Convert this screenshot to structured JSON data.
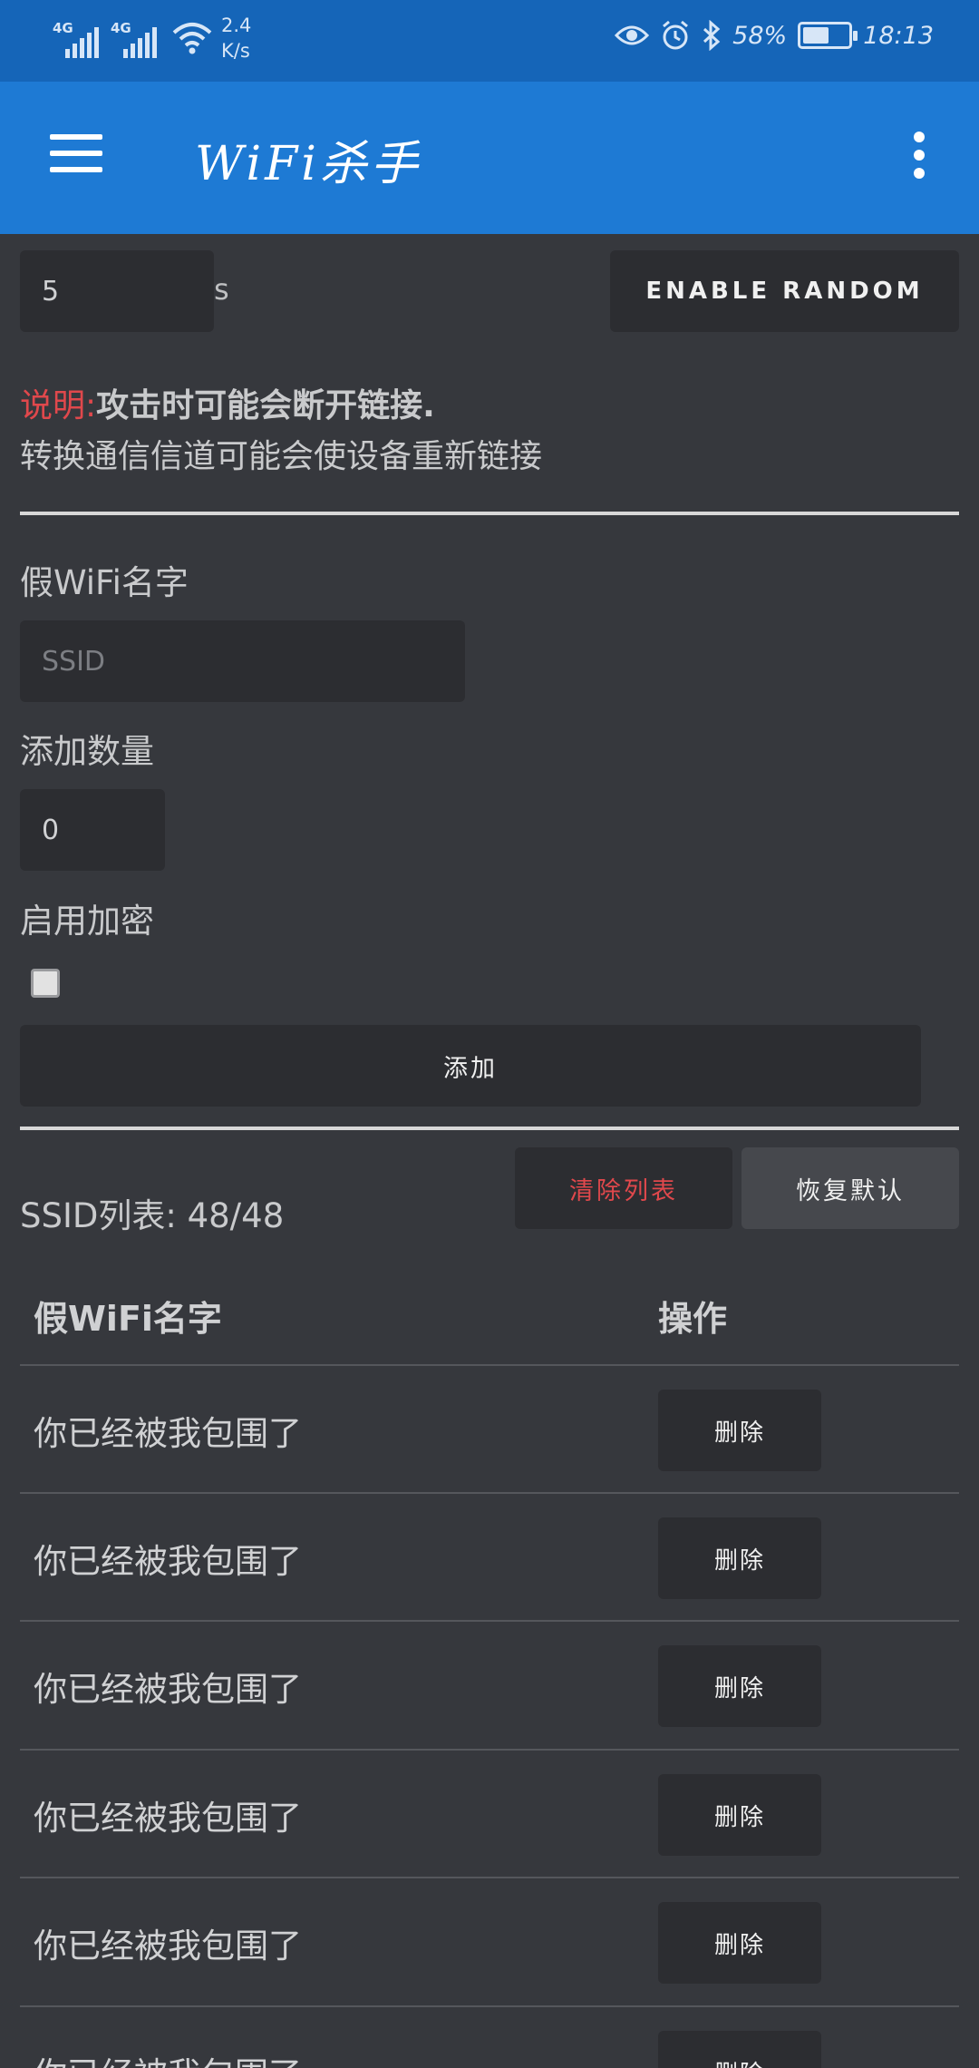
{
  "status_bar": {
    "signal1_label": "4G",
    "signal2_label": "4G",
    "speed_value": "2.4",
    "speed_unit": "K/s",
    "battery_percent": "58%",
    "battery_level": 0.58,
    "time": "18:13"
  },
  "app_bar": {
    "title": "WiFi杀手"
  },
  "channel": {
    "value": "5",
    "unit": "s",
    "enable_random_label": "ENABLE RANDOM"
  },
  "notice": {
    "prefix": "说明:",
    "bold_text": "攻击时可能会断开链接.",
    "line2": "转换通信信道可能会使设备重新链接"
  },
  "form": {
    "ssid_label": "假WiFi名字",
    "ssid_placeholder": "SSID",
    "count_label": "添加数量",
    "count_value": "0",
    "encrypt_label": "启用加密",
    "add_button": "添加"
  },
  "list": {
    "ssid_count_label": "SSID列表: 48/48",
    "clear_button": "清除列表",
    "restore_button": "恢复默认",
    "col_name": "假WiFi名字",
    "col_action": "操作",
    "rows": [
      {
        "name": "你已经被我包围了",
        "action": "删除"
      },
      {
        "name": "你已经被我包围了",
        "action": "删除"
      },
      {
        "name": "你已经被我包围了",
        "action": "删除"
      },
      {
        "name": "你已经被我包围了",
        "action": "删除"
      },
      {
        "name": "你已经被我包围了",
        "action": "删除"
      },
      {
        "name": "你已经被我包围了",
        "action": "删除"
      }
    ]
  },
  "colors": {
    "status_bar": "#1565b8",
    "app_bar": "#1e7ad4",
    "background": "#36383d",
    "button": "#2c2d31",
    "danger_text": "#e0484c"
  }
}
